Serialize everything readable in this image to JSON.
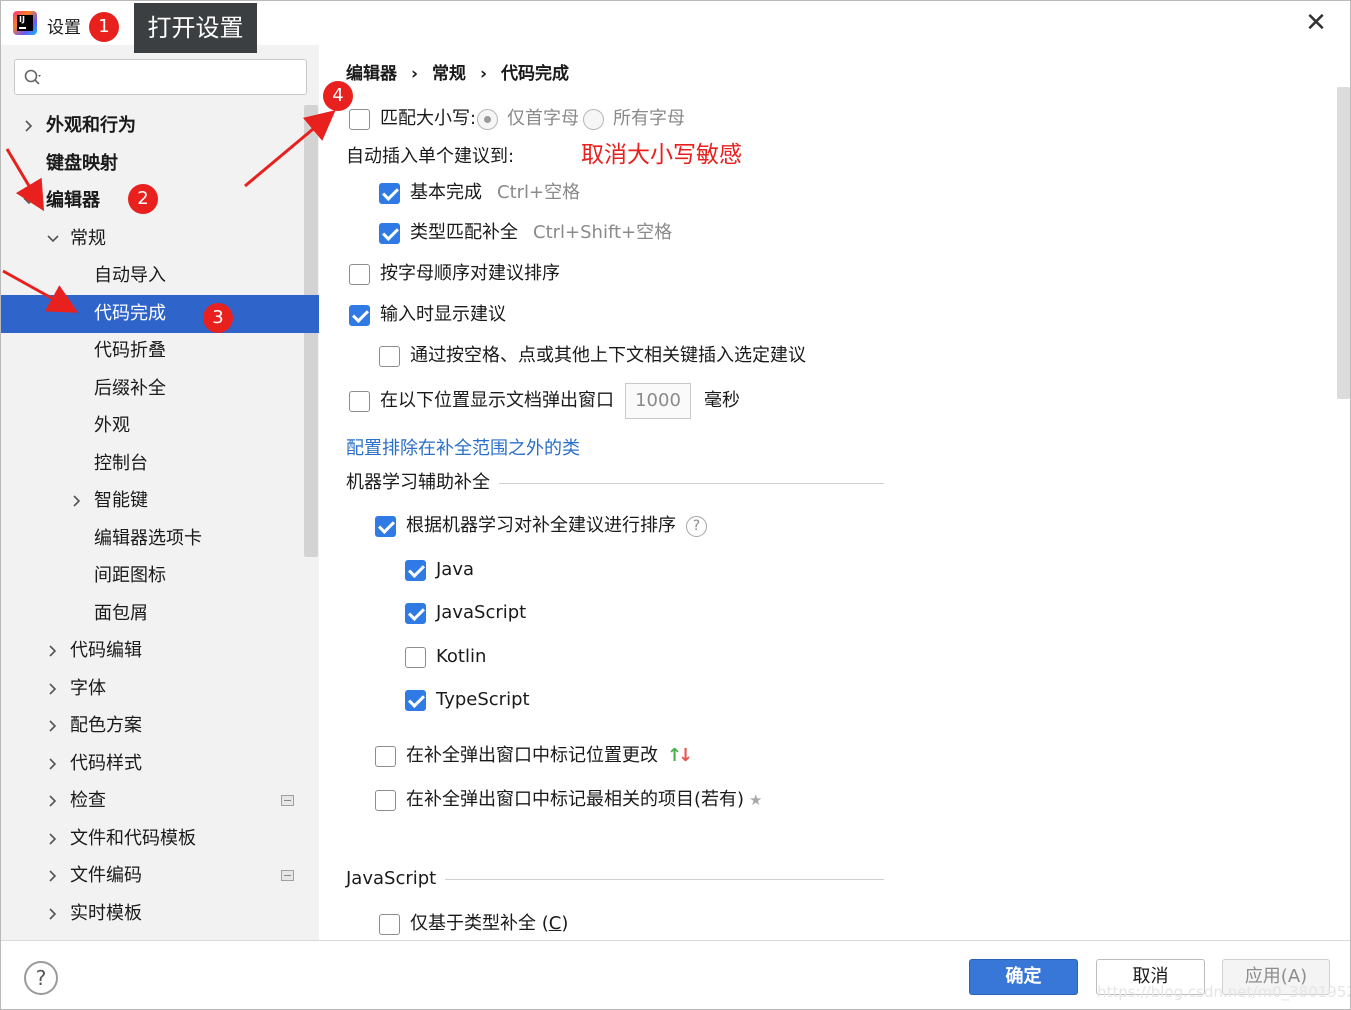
{
  "window": {
    "title": "设置",
    "close_glyph": "✕",
    "app_icon_text": "IJ"
  },
  "annotations": {
    "badges": [
      "1",
      "2",
      "3",
      "4"
    ],
    "tooltip": "打开设置",
    "note": "取消大小写敏感",
    "color": "#e8201e"
  },
  "search": {
    "placeholder": ""
  },
  "tree": {
    "items": [
      {
        "label": "外观和行为",
        "expandable": true
      },
      {
        "label": "键盘映射",
        "expandable": false
      },
      {
        "label": "编辑器",
        "expandable": true,
        "expanded": true
      },
      {
        "label": "常规",
        "expandable": true,
        "expanded": true
      },
      {
        "label": "自动导入"
      },
      {
        "label": "代码完成",
        "selected": true
      },
      {
        "label": "代码折叠"
      },
      {
        "label": "后缀补全"
      },
      {
        "label": "外观"
      },
      {
        "label": "控制台"
      },
      {
        "label": "智能键",
        "expandable": true
      },
      {
        "label": "编辑器选项卡"
      },
      {
        "label": "间距图标"
      },
      {
        "label": "面包屑"
      },
      {
        "label": "代码编辑",
        "expandable": true
      },
      {
        "label": "字体",
        "expandable": true
      },
      {
        "label": "配色方案",
        "expandable": true
      },
      {
        "label": "代码样式",
        "expandable": true
      },
      {
        "label": "检查",
        "expandable": true
      },
      {
        "label": "文件和代码模板",
        "expandable": true
      },
      {
        "label": "文件编码",
        "expandable": true
      },
      {
        "label": "实时模板",
        "expandable": true
      }
    ]
  },
  "breadcrumb": {
    "a": "编辑器",
    "b": "常规",
    "c": "代码完成",
    "sep": "›"
  },
  "options": {
    "match_case": {
      "label": "匹配大小写:",
      "checked": false
    },
    "radio_first": {
      "label": "仅首字母",
      "checked": true
    },
    "radio_all": {
      "label": "所有字母",
      "checked": false
    },
    "auto_insert_title": "自动插入单个建议到:",
    "basic": {
      "label": "基本完成",
      "shortcut": "Ctrl+空格",
      "checked": true
    },
    "smart": {
      "label": "类型匹配补全",
      "shortcut": "Ctrl+Shift+空格",
      "checked": true
    },
    "sort_alpha": {
      "label": "按字母顺序对建议排序",
      "checked": false
    },
    "show_typing": {
      "label": "输入时显示建议",
      "checked": true
    },
    "insert_space": {
      "label": "通过按空格、点或其他上下文相关键插入选定建议",
      "checked": false
    },
    "doc_popup": {
      "label": "在以下位置显示文档弹出窗口",
      "value": "1000",
      "unit": "毫秒",
      "checked": false
    },
    "exclude_link": "配置排除在补全范围之外的类",
    "ml_section": "机器学习辅助补全",
    "ml_sort": {
      "label": "根据机器学习对补全建议进行排序",
      "checked": true,
      "help": "?"
    },
    "java": {
      "label": "Java",
      "checked": true
    },
    "javascript": {
      "label": "JavaScript",
      "checked": true
    },
    "kotlin": {
      "label": "Kotlin",
      "checked": false
    },
    "typescript": {
      "label": "TypeScript",
      "checked": true
    },
    "mark_position": {
      "label": "在补全弹出窗口中标记位置更改",
      "checked": false,
      "up": "↑",
      "down": "↓"
    },
    "mark_relevant": {
      "label": "在补全弹出窗口中标记最相关的项目(若有)",
      "checked": false,
      "star": "★"
    },
    "js_section": "JavaScript",
    "type_only": {
      "label": "仅基于类型补全 (",
      "mnemonic": "C",
      "label_end": ")",
      "checked": false
    }
  },
  "buttons": {
    "help": "?",
    "ok": "确定",
    "cancel": "取消",
    "apply": "应用(A)"
  },
  "watermark": "https://blog.csdn.net/m0_38019521",
  "colors": {
    "accent": "#2f7ae5",
    "selection": "#2f65ca",
    "link": "#2a6fc9",
    "ok_button": "#3876d8"
  }
}
